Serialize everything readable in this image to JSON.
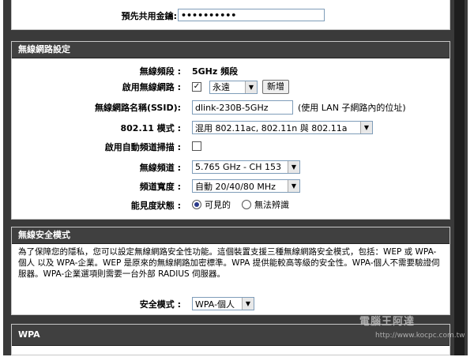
{
  "top_panel": {
    "psk_label": "預先共用金鑰:",
    "psk_value": "••••••••••"
  },
  "wireless_panel": {
    "title": "無線網路設定",
    "band_label": "無線頻段 :",
    "band_value": "5GHz 頻段",
    "enable_label": "啟用無線網路 :",
    "enable_checked": "✓",
    "schedule_value": "永遠",
    "new_button": "新增",
    "ssid_label": "無線網路名稱(SSID):",
    "ssid_value": "dlink-230B-5GHz",
    "ssid_hint": "(使用 LAN 子網路內的位址)",
    "mode_label": "802.11 模式 :",
    "mode_value": "混用 802.11ac, 802.11n 與 802.11a",
    "autochannel_label": "啟用自動頻道掃描 :",
    "channel_label": "無線頻道 :",
    "channel_value": "5.765 GHz - CH 153",
    "width_label": "頻道寬度 :",
    "width_value": "自動 20/40/80 MHz",
    "visibility_label": "能見度狀態 :",
    "visible_option": "可見的",
    "invisible_option": "無法辨識"
  },
  "security_panel": {
    "title": "無線安全模式",
    "description": "為了保障您的隱私，您可以設定無線網路安全性功能。這個裝置支援三種無線網路安全模式，包括：WEP 或 WPA-個人 以及 WPA-企業。WEP 是原來的無線網路加密標準。WPA 提供能較高等級的安全性。WPA-個人不需要驗證伺服器。WPA-企業選項則需要一台外部 RADIUS 伺服器。",
    "mode_label": "安全模式 :",
    "mode_value": "WPA-個人"
  },
  "wpa_panel": {
    "title": "WPA"
  },
  "watermark": {
    "line1": "電腦王阿達",
    "line2": "http://www.kocpc.com.tw"
  }
}
